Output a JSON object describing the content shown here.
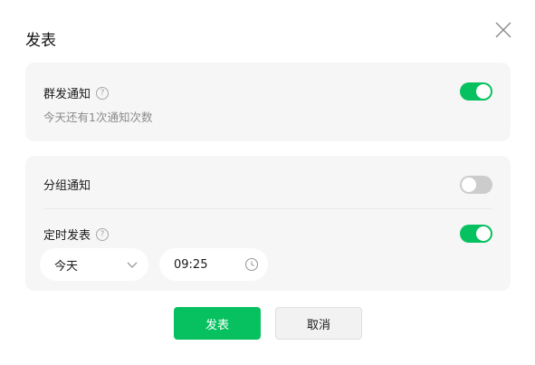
{
  "dialog": {
    "title": "发表",
    "close_icon": "close-icon"
  },
  "group_notify": {
    "label": "群发通知",
    "help_icon": "help-icon",
    "help_glyph": "?",
    "subtext": "今天还有1次通知次数",
    "enabled": true
  },
  "grouped_notify": {
    "label": "分组通知",
    "enabled": false
  },
  "scheduled_publish": {
    "label": "定时发表",
    "help_icon": "help-icon",
    "help_glyph": "?",
    "enabled": true,
    "day": {
      "value": "今天",
      "icon": "chevron-down-icon"
    },
    "time": {
      "value": "09:25",
      "icon": "clock-icon"
    }
  },
  "footer": {
    "publish_label": "发表",
    "cancel_label": "取消"
  },
  "colors": {
    "accent": "#07c160",
    "toggle_off": "#cccccc",
    "card_bg": "#f6f6f6"
  }
}
